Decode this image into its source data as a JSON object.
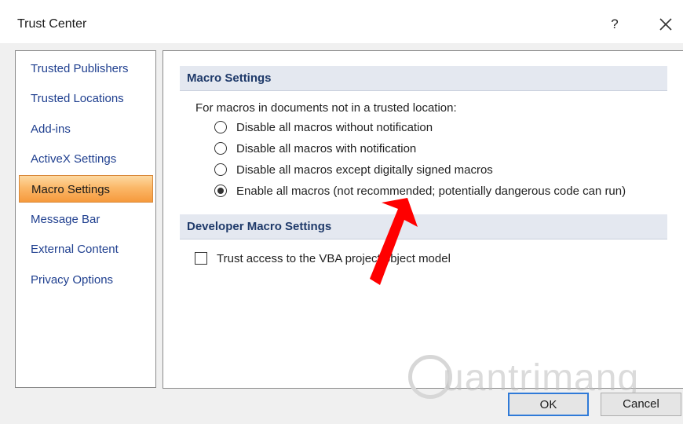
{
  "window": {
    "title": "Trust Center",
    "help_label": "?",
    "close_icon": "close-icon"
  },
  "sidebar": {
    "items": [
      {
        "label": "Trusted Publishers",
        "selected": false
      },
      {
        "label": "Trusted Locations",
        "selected": false
      },
      {
        "label": "Add-ins",
        "selected": false
      },
      {
        "label": "ActiveX Settings",
        "selected": false
      },
      {
        "label": "Macro Settings",
        "selected": true
      },
      {
        "label": "Message Bar",
        "selected": false
      },
      {
        "label": "External Content",
        "selected": false
      },
      {
        "label": "Privacy Options",
        "selected": false
      }
    ]
  },
  "macro_settings": {
    "header": "Macro Settings",
    "intro": "For macros in documents not in a trusted location:",
    "options": [
      {
        "label": "Disable all macros without notification",
        "checked": false
      },
      {
        "label": "Disable all macros with notification",
        "checked": false
      },
      {
        "label": "Disable all macros except digitally signed macros",
        "checked": false
      },
      {
        "label": "Enable all macros (not recommended; potentially dangerous code can run)",
        "checked": true
      }
    ]
  },
  "developer_settings": {
    "header": "Developer Macro Settings",
    "checkbox_label": "Trust access to the VBA project object model",
    "checked": false
  },
  "buttons": {
    "ok": "OK",
    "cancel": "Cancel"
  },
  "watermark": {
    "text": "uantrimang"
  },
  "colors": {
    "selected_nav": "#f9a54a",
    "annotation_arrow": "#ff0000",
    "section_header_bg": "#e4e8f0",
    "ok_border": "#2f7ad8"
  }
}
